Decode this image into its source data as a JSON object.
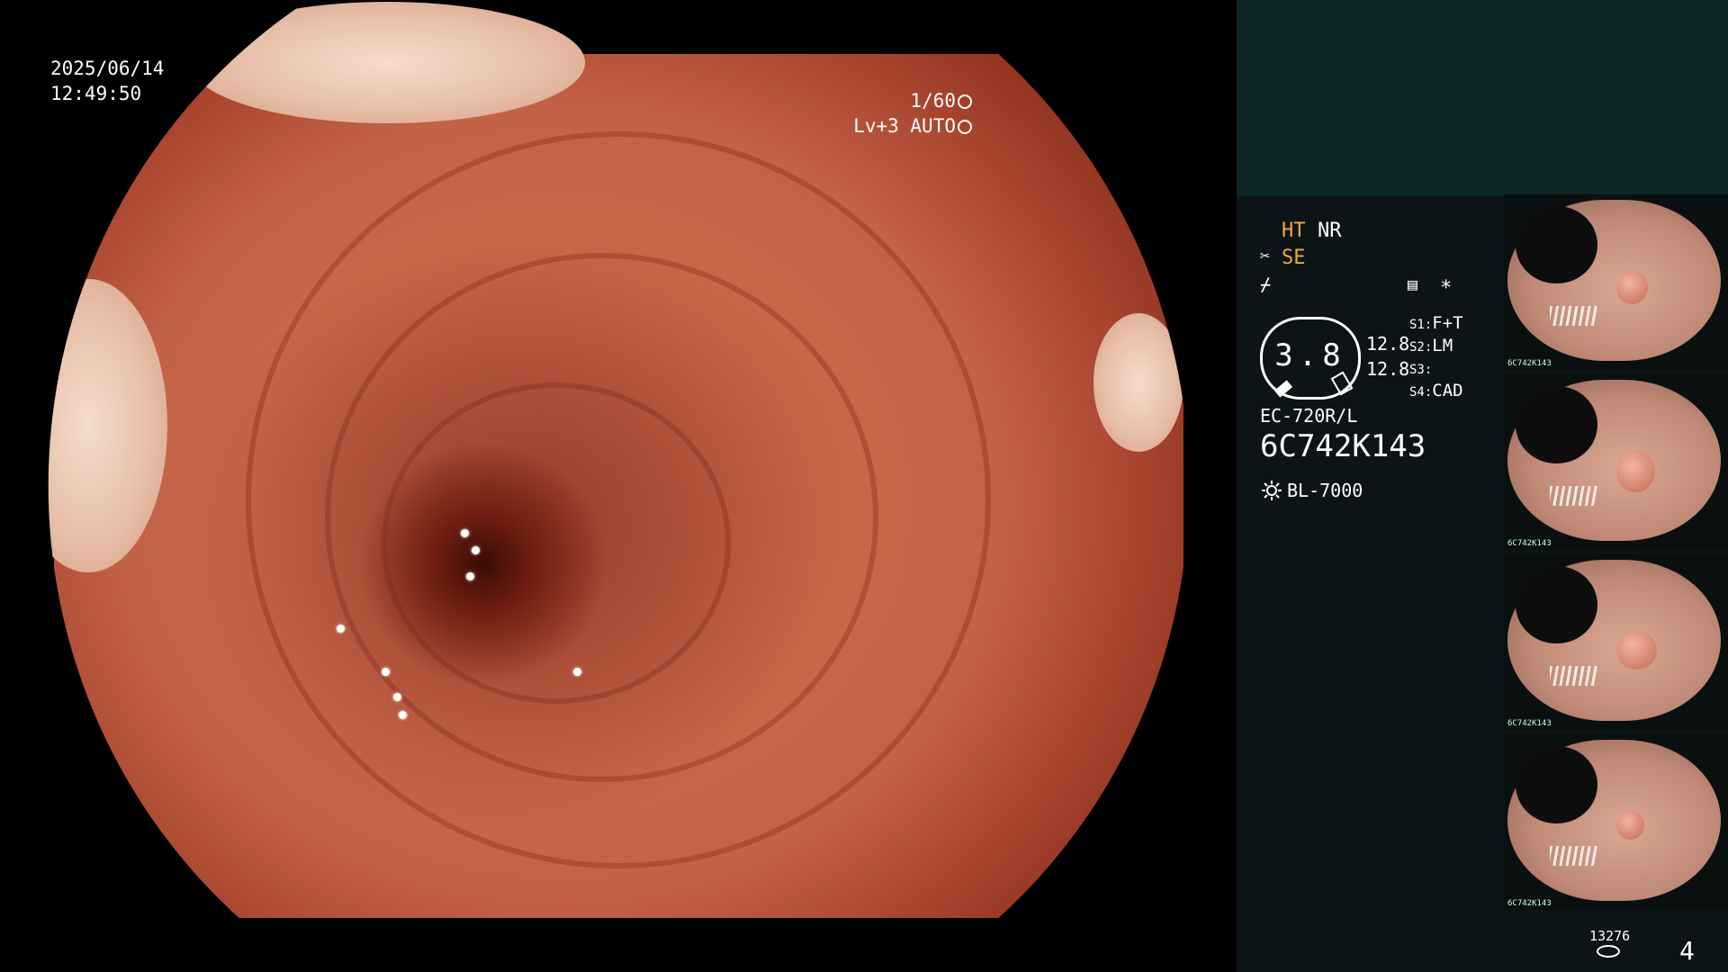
{
  "osd": {
    "date": "2025/06/14",
    "time": "12:49:50",
    "shutter": "1/60",
    "exposure": "Lv+3 AUTO"
  },
  "panel": {
    "ht": "HT",
    "nr": "NR",
    "se": "SE",
    "zoom_value": "3.8",
    "val1": "12.8",
    "val2": "12.8",
    "s1_key": "S1:",
    "s1_val": "F+T",
    "s2_key": "S2:",
    "s2_val": "LM",
    "s3_key": "S3:",
    "s3_val": "",
    "s4_key": "S4:",
    "s4_val": "CAD",
    "asterisk": "*",
    "scope_model": "EC-720R/L",
    "scope_serial": "6C742K143",
    "light_source": "BL-7000",
    "accent_color": "#f0a93a"
  },
  "thumbnails": [
    {
      "label": "6C742K143"
    },
    {
      "label": "6C742K143"
    },
    {
      "label": "6C742K143"
    },
    {
      "label": "6C742K143"
    }
  ],
  "footer": {
    "storage_count": "13276",
    "image_count": "4"
  },
  "icons": [
    "shutter-icon",
    "auto-icon",
    "scissors-icon",
    "lightning-icon",
    "memory-icon",
    "sun-icon",
    "disk-icon"
  ]
}
